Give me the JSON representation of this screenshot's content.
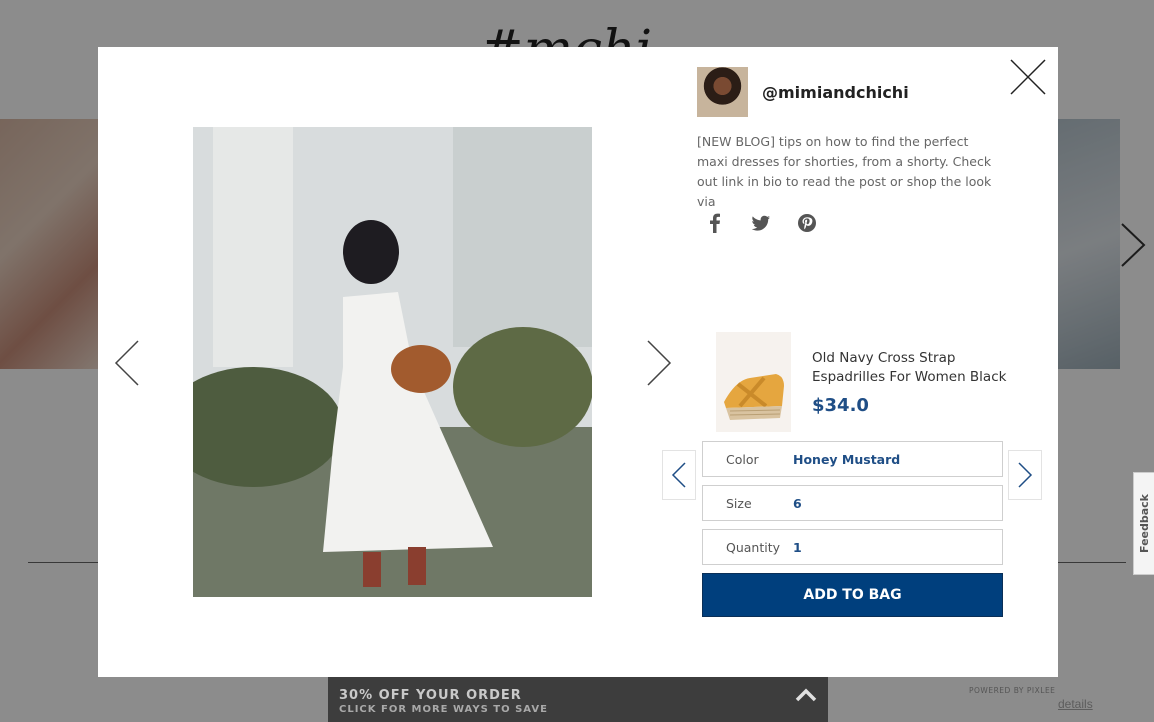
{
  "background": {
    "logo_text": "#mchi",
    "details_link": "details"
  },
  "modal": {
    "user": {
      "username": "@mimiandchichi"
    },
    "caption": "[NEW BLOG] tips on how to find the perfect maxi dresses for shorties, from a shorty. Check out link in bio to read the post or shop the look via",
    "share_icons": [
      "facebook-icon",
      "twitter-icon",
      "pinterest-icon"
    ],
    "product": {
      "name": "Old Navy Cross Strap Espadrilles For Women Black",
      "price": "$34.0"
    },
    "options": {
      "color": {
        "label": "Color",
        "value": "Honey Mustard"
      },
      "size": {
        "label": "Size",
        "value": "6"
      },
      "quantity": {
        "label": "Quantity",
        "value": "1"
      }
    },
    "add_to_bag_label": "ADD TO BAG",
    "powered_by": "POWERED BY PIXLEE"
  },
  "feedback_tab": {
    "label": "Feedback"
  },
  "promo": {
    "title": "30% OFF YOUR ORDER",
    "subtitle": "CLICK FOR MORE WAYS TO SAVE"
  },
  "colors": {
    "accent": "#003f7d",
    "link": "#1f4e86",
    "promo_bg": "#3d3d3d",
    "overlay": "rgba(0,0,0,0.45)"
  }
}
